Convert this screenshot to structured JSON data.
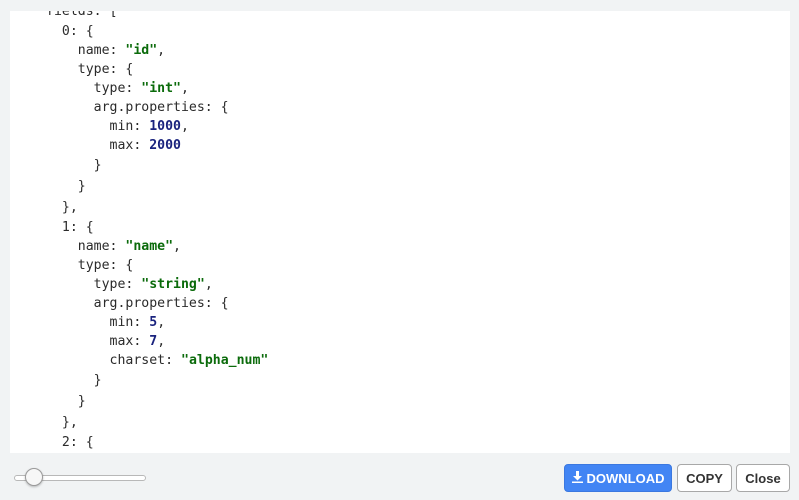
{
  "code": {
    "fields_key": "fields: [",
    "field0": {
      "index": "0: {",
      "name_key": "name: ",
      "name_value": "\"id\"",
      "type_key": "type: {",
      "type_type_key": "type: ",
      "type_value": "\"int\"",
      "arg_key": "arg.properties: {",
      "min_key": "min: ",
      "min_value": "1000",
      "max_key": "max: ",
      "max_value": "2000"
    },
    "field1": {
      "index": "1: {",
      "name_key": "name: ",
      "name_value": "\"name\"",
      "type_key": "type: {",
      "type_type_key": "type: ",
      "type_value": "\"string\"",
      "arg_key": "arg.properties: {",
      "min_key": "min: ",
      "min_value": "5",
      "max_key": "max: ",
      "max_value": "7",
      "charset_key": "charset: ",
      "charset_value": "\"alpha_num\""
    },
    "field2_index": "2: {",
    "close_brace": "}",
    "close_brace_comma": "},",
    "comma": ","
  },
  "footer": {
    "download_label": "DOWNLOAD",
    "copy_label": "COPY",
    "close_label": "Close",
    "slider_value": 0.15
  },
  "icons": {
    "download": "download-icon"
  },
  "colors": {
    "string": "#0b6b0b",
    "number": "#1a237e",
    "accent": "#4285f4",
    "background": "#f1f3f4"
  }
}
